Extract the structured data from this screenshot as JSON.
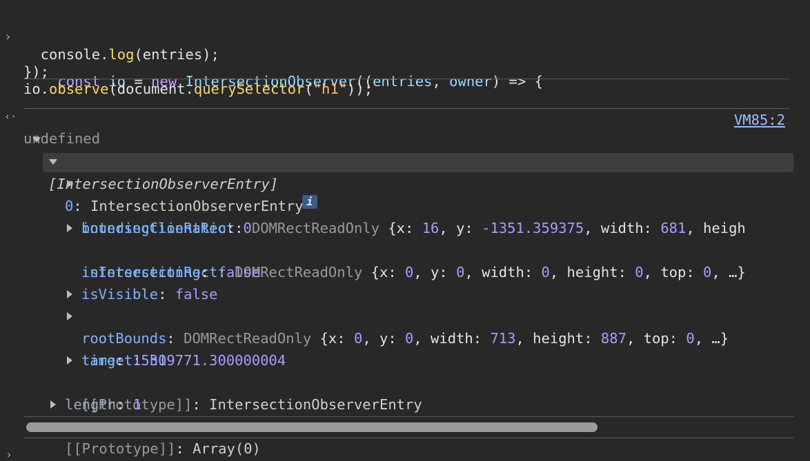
{
  "input": {
    "line1": {
      "t1": "const",
      "t2": " ",
      "t3": "io",
      "t4": " = ",
      "t5": "new",
      "t6": " ",
      "t7": "IntersectionObserver",
      "t8": "((",
      "t9": "entries",
      "t10": ", ",
      "t11": "owner",
      "t12": ") => {"
    },
    "line2": {
      "t1": "  console.",
      "t2": "log",
      "t3": "(entries);"
    },
    "line3": {
      "t1": "});"
    },
    "line4": {
      "t1": "io.",
      "t2": "observe",
      "t3": "(document.",
      "t4": "querySelector",
      "t5": "(",
      "t6": "\"h1\"",
      "t7": "));"
    }
  },
  "result": {
    "text": "undefined"
  },
  "log": {
    "source_link": "VM85:2",
    "array_label": "[IntersectionObserverEntry]",
    "info_badge": "i",
    "entry_index": "0",
    "entry_class": "IntersectionObserverEntry",
    "props": {
      "boundingClientRect": {
        "key": "boundingClientRect",
        "cls": "DOMRectReadOnly",
        "x": "16",
        "y": "-1351.359375",
        "width": "681",
        "tail": "heigh"
      },
      "intersectionRatio": {
        "key": "intersectionRatio",
        "value": "0"
      },
      "intersectionRect": {
        "key": "intersectionRect",
        "cls": "DOMRectReadOnly",
        "x": "0",
        "y": "0",
        "width": "0",
        "height": "0",
        "top": "0"
      },
      "isIntersecting": {
        "key": "isIntersecting",
        "value": "false"
      },
      "isVisible": {
        "key": "isVisible",
        "value": "false"
      },
      "rootBounds": {
        "key": "rootBounds",
        "cls": "DOMRectReadOnly",
        "x": "0",
        "y": "0",
        "width": "713",
        "height": "887",
        "top": "0"
      },
      "target": {
        "key": "target",
        "value": "h1"
      },
      "time": {
        "key": "time",
        "value": "15309771.300000004"
      },
      "entryPrototype": {
        "key": "[[Prototype]]",
        "value": "IntersectionObserverEntry"
      }
    },
    "length": {
      "key": "length",
      "value": "1"
    },
    "arrayPrototype": {
      "key": "[[Prototype]]",
      "value": "Array(0)"
    }
  },
  "glyphs": {
    "prompt": "›",
    "result": "‹·",
    "bottom_prompt": "›"
  }
}
